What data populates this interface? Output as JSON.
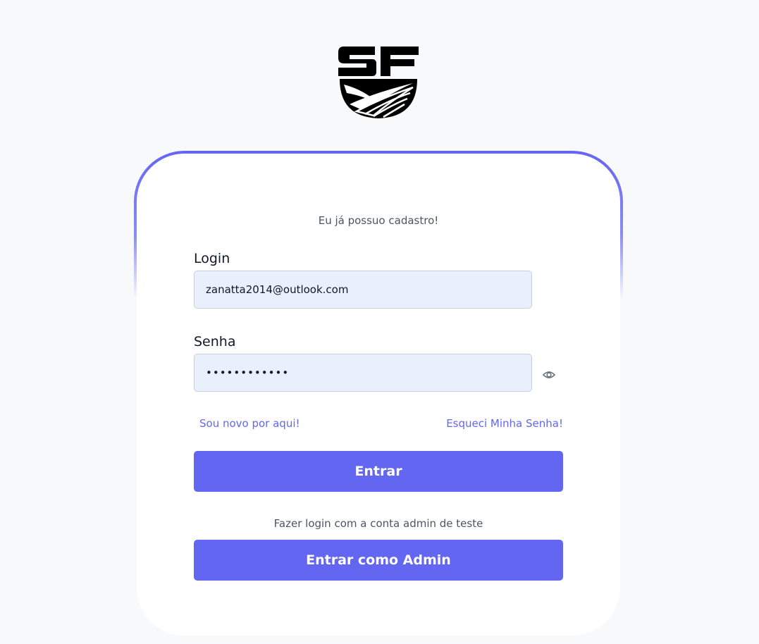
{
  "brand": {
    "logo_text": "SF"
  },
  "card": {
    "subtitle": "Eu já possuo cadastro!",
    "login_label": "Login",
    "login_value": "zanatta2014@outlook.com",
    "password_label": "Senha",
    "password_value": "••••••••••••",
    "signup_link": "Sou novo por aqui!",
    "forgot_link": "Esqueci Minha Senha!",
    "submit_label": "Entrar",
    "admin_helper": "Fazer login com a conta admin de teste",
    "admin_label": "Entrar como Admin"
  },
  "colors": {
    "accent": "#6366f1",
    "input_bg": "#e8f0fc",
    "page_bg": "#f8f9fb"
  },
  "icons": {
    "logo": "sf-logo-icon",
    "password_toggle": "eye-icon"
  }
}
